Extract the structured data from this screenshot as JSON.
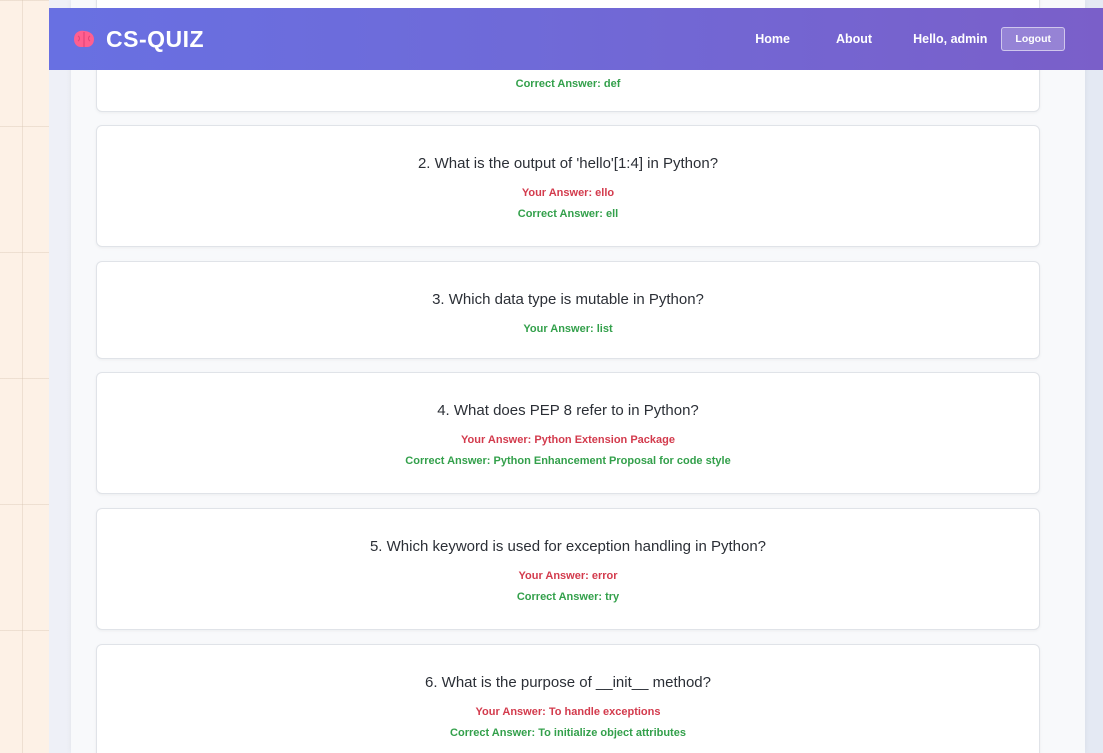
{
  "navbar": {
    "brand": "CS-QUIZ",
    "links": [
      "Home",
      "About"
    ],
    "greeting": "Hello, admin",
    "logout_label": "Logout"
  },
  "partial_card": {
    "correct_answer": "Correct Answer: def"
  },
  "questions": [
    {
      "text": "2. What is the output of 'hello'[1:4] in Python?",
      "your_answer": "Your Answer: ello",
      "correct_answer": "Correct Answer: ell"
    },
    {
      "text": "3. Which data type is mutable in Python?",
      "your_answer": "Your Answer: list"
    },
    {
      "text": "4. What does PEP 8 refer to in Python?",
      "your_answer": "Your Answer: Python Extension Package",
      "correct_answer": "Correct Answer: Python Enhancement Proposal for code style"
    },
    {
      "text": "5. Which keyword is used for exception handling in Python?",
      "your_answer": "Your Answer: error",
      "correct_answer": "Correct Answer: try"
    },
    {
      "text": "6. What is the purpose of __init__ method?",
      "your_answer": "Your Answer: To handle exceptions",
      "correct_answer": "Correct Answer: To initialize object attributes"
    }
  ],
  "colors": {
    "wrong_answer": "#d33b4d",
    "correct_answer": "#33a04b",
    "navbar_start": "#6870e2",
    "navbar_end": "#7a5fc9"
  },
  "icons": {
    "brand_logo": "brain-icon"
  }
}
